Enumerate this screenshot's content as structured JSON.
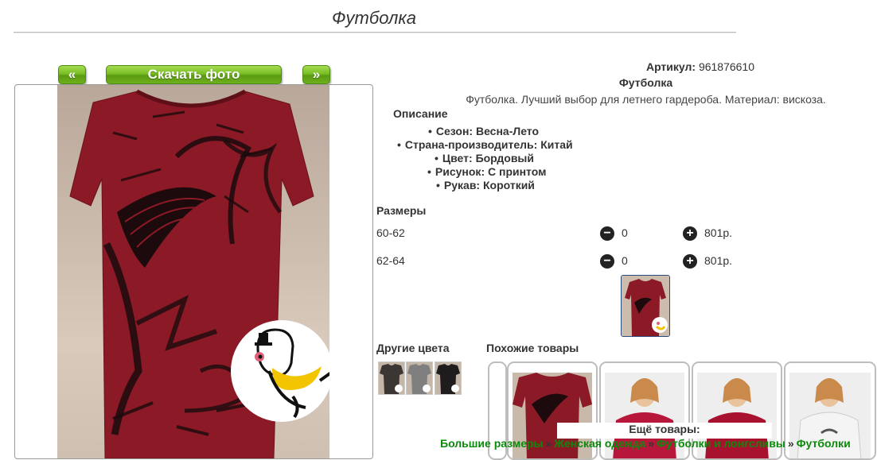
{
  "page": {
    "title": "Футболка"
  },
  "photo_nav": {
    "prev_label": "«",
    "download_label": "Скачать фото",
    "next_label": "»"
  },
  "product": {
    "article_label": "Артикул:",
    "article_value": "961876610",
    "name": "Футболка",
    "description": "Футболка. Лучший выбор для летнего гардероба. Материал: вискоза."
  },
  "description_block": {
    "heading": "Описание",
    "attributes": [
      "Сезон: Весна-Лето",
      "Страна-производитель: Китай",
      "Цвет: Бордовый",
      "Рисунок: С принтом",
      "Рукав: Короткий"
    ]
  },
  "sizes": {
    "heading": "Размеры",
    "rows": [
      {
        "size": "60-62",
        "qty": "0",
        "price": "801р."
      },
      {
        "size": "62-64",
        "qty": "0",
        "price": "801р."
      }
    ]
  },
  "other_colors": {
    "heading": "Другие цвета"
  },
  "similar_products": {
    "heading": "Похожие товары"
  },
  "more_products": {
    "heading": "Ещё товары:",
    "breadcrumb": [
      "Большие размеры",
      "Женская одежда",
      "Футболки и лонгсливы",
      "Футболки"
    ],
    "separator": "»"
  },
  "colors": {
    "button_green": "#79bd25",
    "shirt_burgundy": "#8c1a26",
    "link_green": "#0b8a0b",
    "frame_border": "#9a9a9a"
  },
  "icons": {
    "minus": "minus-circle-icon",
    "plus": "plus-circle-icon",
    "logo": "bird-logo-icon"
  }
}
